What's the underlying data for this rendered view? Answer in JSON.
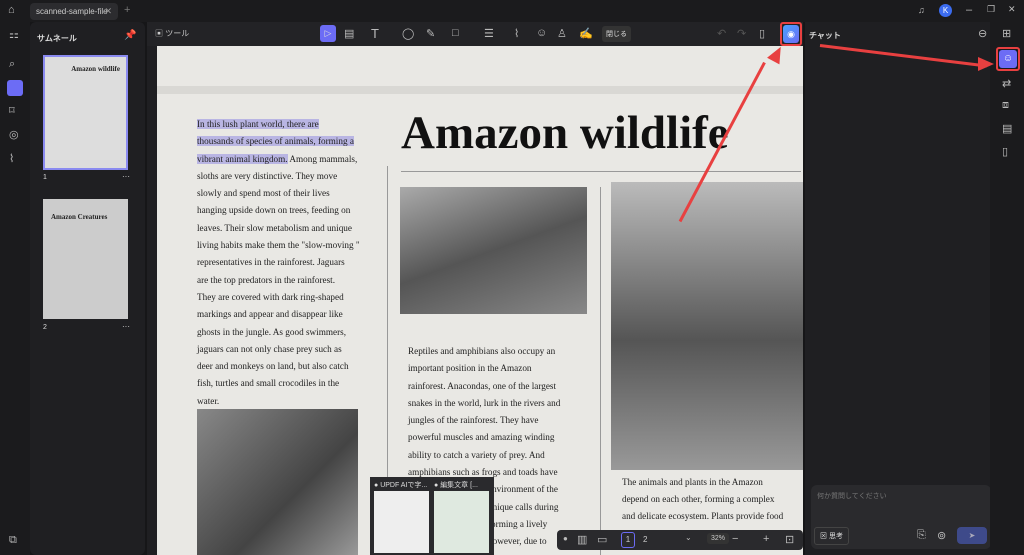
{
  "titlebar": {
    "tab_title": "scanned-sample-file",
    "close": "✕",
    "new_tab": "+",
    "avatar": "K"
  },
  "left_panel": {
    "title": "サムネール",
    "pages": [
      {
        "number": "1",
        "title": "Amazon wildlife"
      },
      {
        "number": "2",
        "title": "Amazon Creatures"
      }
    ],
    "more": "···"
  },
  "toolbar": {
    "tools_label": "ツール",
    "close_label": "閉じる"
  },
  "document": {
    "title": "Amazon wildlife",
    "left_column_highlighted": [
      "In this lush plant world, there are",
      "thousands of species of animals, forming a",
      "vibrant animal kingdom."
    ],
    "left_column": [
      " Among mammals,",
      "sloths are very distinctive. They move",
      "slowly and spend most of their lives",
      "hanging upside down on trees, feeding on",
      "leaves. Their slow metabolism and unique",
      "living habits make them the \"slow-moving \"",
      "representatives in the rainforest. Jaguars",
      "are the top predators in the rainforest.",
      "They are covered with dark ring-shaped",
      "markings and appear and disappear like",
      "ghosts in the jungle. As good swimmers,",
      "jaguars can not only chase prey such as",
      "deer and monkeys on land, but also catch",
      "fish, turtles and small crocodiles in the",
      "water."
    ],
    "middle_column": [
      "Reptiles and amphibians also occupy an",
      "important position in the Amazon",
      "rainforest. Anacondas, one of the largest",
      "snakes in the world, lurk in the rivers and",
      "jungles of the rainforest. They have",
      "powerful muscles and amazing winding",
      "ability to catch a variety of prey. And",
      "amphibians such as frogs and toads have",
      "environment of the",
      "unique calls during",
      "forming a lively",
      "however, due to"
    ],
    "right_column": [
      "The animals and plants in the Amazon",
      "depend on each other, forming a complex",
      "and delicate ecosystem. Plants provide food"
    ]
  },
  "taskbar_popup": [
    {
      "title": "UPDF AIで字..."
    },
    {
      "title": "編集文章 [..."
    }
  ],
  "bottom_bar": {
    "page_current": "1",
    "page_next": "2",
    "zoom": "32%",
    "minus": "−",
    "plus": "+"
  },
  "chat": {
    "title": "チャット",
    "placeholder": "何か質問してください",
    "think_label": "思考",
    "send": "➤"
  }
}
